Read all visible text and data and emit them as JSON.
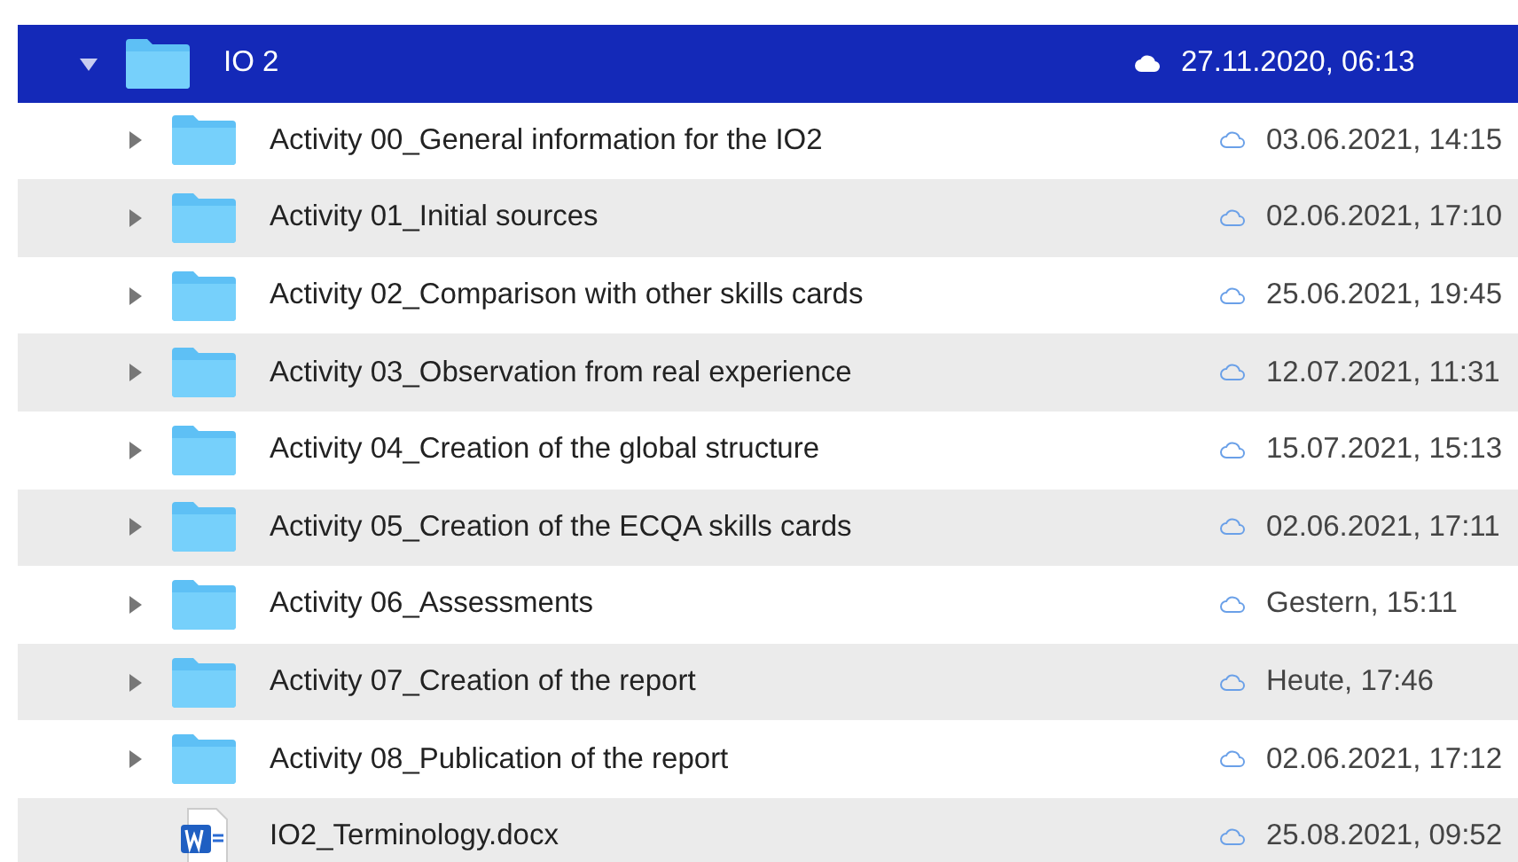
{
  "tree": {
    "name": "IO 2",
    "kind": "folder",
    "date": "27.11.2020, 06:13",
    "expanded": true,
    "selected": true,
    "children": [
      {
        "name": "Activity 00_General information for the IO2",
        "kind": "folder",
        "date": "03.06.2021, 14:15",
        "expanded": false,
        "selected": false
      },
      {
        "name": "Activity 01_Initial sources",
        "kind": "folder",
        "date": "02.06.2021, 17:10",
        "expanded": false,
        "selected": false
      },
      {
        "name": "Activity 02_Comparison with other skills cards",
        "kind": "folder",
        "date": "25.06.2021, 19:45",
        "expanded": false,
        "selected": false
      },
      {
        "name": "Activity 03_Observation from real experience",
        "kind": "folder",
        "date": "12.07.2021, 11:31",
        "expanded": false,
        "selected": false
      },
      {
        "name": "Activity 04_Creation of the global structure",
        "kind": "folder",
        "date": "15.07.2021, 15:13",
        "expanded": false,
        "selected": false
      },
      {
        "name": "Activity 05_Creation of the ECQA skills cards",
        "kind": "folder",
        "date": "02.06.2021, 17:11",
        "expanded": false,
        "selected": false
      },
      {
        "name": "Activity 06_Assessments",
        "kind": "folder",
        "date": "Gestern, 15:11",
        "expanded": false,
        "selected": false
      },
      {
        "name": "Activity 07_Creation of the report",
        "kind": "folder",
        "date": "Heute, 17:46",
        "expanded": false,
        "selected": false
      },
      {
        "name": "Activity 08_Publication of the report",
        "kind": "folder",
        "date": "02.06.2021, 17:12",
        "expanded": false,
        "selected": false
      },
      {
        "name": "IO2_Terminology.docx",
        "kind": "document",
        "date": "25.08.2021, 09:52",
        "selected": false
      }
    ]
  }
}
